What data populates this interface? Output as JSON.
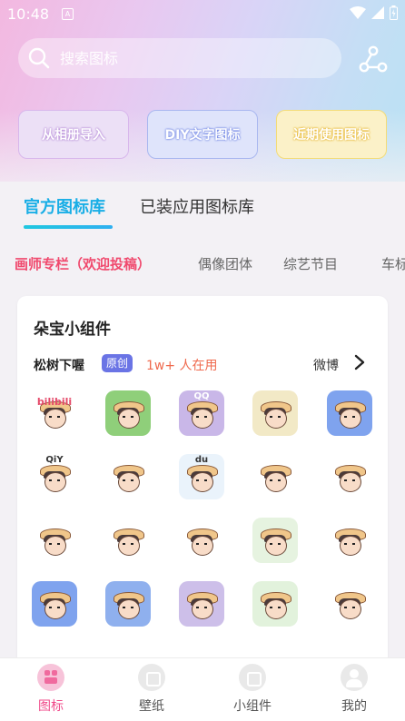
{
  "status_bar": {
    "time": "10:48"
  },
  "search": {
    "placeholder": "搜索图标"
  },
  "quick_actions": [
    {
      "label": "从相册导入"
    },
    {
      "label": "DIY文字图标"
    },
    {
      "label": "近期使用图标"
    }
  ],
  "tabs": [
    {
      "label": "官方图标库",
      "active": true
    },
    {
      "label": "已装应用图标库",
      "active": false
    }
  ],
  "categories": [
    {
      "label": "画师专栏（欢迎投稿）",
      "active": true
    },
    {
      "label": "偶像团体",
      "active": false
    },
    {
      "label": "综艺节目",
      "active": false
    },
    {
      "label": "车标",
      "active": false
    }
  ],
  "card": {
    "title": "朵宝小组件",
    "author": "松树下喔",
    "badge": "原创",
    "users": "1w+ 人在用",
    "source": "微博",
    "icons": [
      {
        "name": "bilibili-app-icon",
        "text": "bilibili",
        "bg": "#ffffff"
      },
      {
        "name": "wechat-style-icon",
        "text": "",
        "bg": "#8fcf7a"
      },
      {
        "name": "qq-app-icon",
        "text": "QQ",
        "bg": "#c9b7e8"
      },
      {
        "name": "weibo-style-icon",
        "text": "",
        "bg": "#f2e9c6"
      },
      {
        "name": "laptop-app-icon",
        "text": "",
        "bg": "#7fa3ee"
      },
      {
        "name": "tv-app-icon",
        "text": "QiY",
        "bg": "#ffffff"
      },
      {
        "name": "paw-app-icon",
        "text": "",
        "bg": "#ffffff"
      },
      {
        "name": "cloud-app-icon",
        "text": "du",
        "bg": "#eaf3fb"
      },
      {
        "name": "flying-app-icon",
        "text": "",
        "bg": "#ffffff"
      },
      {
        "name": "notes-app-icon",
        "text": "",
        "bg": "#ffffff"
      },
      {
        "name": "music-girl-icon",
        "text": "",
        "bg": "#ffffff"
      },
      {
        "name": "scan-app-icon",
        "text": "",
        "bg": "#ffffff"
      },
      {
        "name": "zhihu-style-icon",
        "text": "",
        "bg": "#ffffff"
      },
      {
        "name": "maps-app-icon",
        "text": "",
        "bg": "#e6f3e0"
      },
      {
        "name": "car-app-icon",
        "text": "",
        "bg": "#ffffff"
      },
      {
        "name": "phone-app-icon",
        "text": "",
        "bg": "#7fa3ee"
      },
      {
        "name": "wings-app-icon",
        "text": "",
        "bg": "#8fb0ee"
      },
      {
        "name": "tiktok-style-icon",
        "text": "",
        "bg": "#cdbfe9"
      },
      {
        "name": "green-app-icon",
        "text": "",
        "bg": "#e2f2dc"
      },
      {
        "name": "ie-style-icon",
        "text": "",
        "bg": "#ffffff"
      }
    ]
  },
  "bottom_nav": [
    {
      "label": "图标",
      "active": true
    },
    {
      "label": "壁纸",
      "active": false
    },
    {
      "label": "小组件",
      "active": false
    },
    {
      "label": "我的",
      "active": false
    }
  ],
  "colors": {
    "accent_tab": "#19aee6",
    "accent_category": "#f04a6e",
    "badge_bg": "#6a74e5"
  }
}
